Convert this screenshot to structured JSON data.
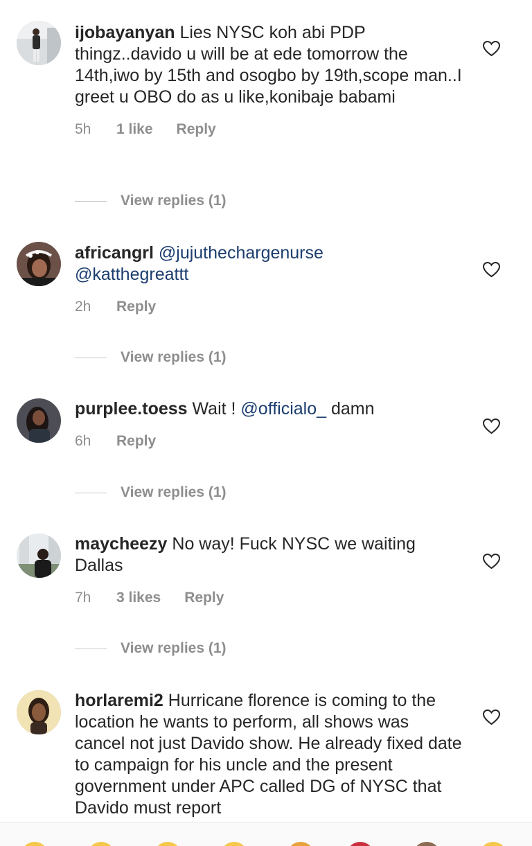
{
  "comments": [
    {
      "username": "ijobayanyan",
      "text": " Lies NYSC koh abi PDP thingz..davido u will be at ede tomorrow the 14th,iwo by 15th and osogbo by 19th,scope man..I greet u OBO do as u like,konibaje babami",
      "time": "5h",
      "likes": "1 like",
      "reply": "Reply",
      "view_replies": "View replies (1)"
    },
    {
      "username": "africangrl",
      "mention1": "@jujuthechargenurse",
      "mention2": "@katthegreattt",
      "time": "2h",
      "reply": "Reply",
      "view_replies": "View replies (1)"
    },
    {
      "username": "purplee.toess",
      "text_before": " Wait ! ",
      "mention": "@officialo_",
      "text_after": " damn",
      "time": "6h",
      "reply": "Reply",
      "view_replies": "View replies (1)"
    },
    {
      "username": "maycheezy",
      "text": " No way! Fuck NYSC we waiting Dallas",
      "time": "7h",
      "likes": "3 likes",
      "reply": "Reply",
      "view_replies": "View replies (1)"
    },
    {
      "username": "horlaremi2",
      "text": " Hurricane florence is coming to the location he wants to perform, all shows was cancel not just Davido show. He already fixed date to campaign for his uncle and the present government under APC called DG of NYSC that Davido must report"
    }
  ],
  "icons": {
    "like": "heart-outline-icon"
  },
  "colors": {
    "text": "#262626",
    "muted": "#8e8e8e",
    "mention": "#1b3d6e"
  }
}
